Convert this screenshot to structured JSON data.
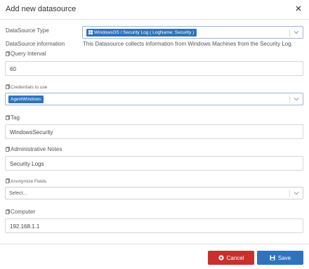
{
  "dialog": {
    "title": "Add new datasource"
  },
  "datasource_type": {
    "label": "DataSource Type",
    "selected": "WindowsOS / Security Log ( LogName: Security )"
  },
  "datasource_info": {
    "label": "DataSource information",
    "text": "This Datasource collects information from Windows Machines from the Security Log."
  },
  "query_interval": {
    "label": "Query Interval",
    "value": "60"
  },
  "credentials": {
    "label": "Credentials to use",
    "selected": "AgentWindows"
  },
  "tag": {
    "label": "Tag",
    "value": "WindowsSecurity"
  },
  "admin_notes": {
    "label": "Administrative Notes",
    "value": "Security Logs"
  },
  "anonymize": {
    "label": "Anonymize Fields",
    "placeholder": "Select..."
  },
  "computer": {
    "label": "Computer",
    "value": "192.168.1.1"
  },
  "buttons": {
    "cancel": "Cancel",
    "save": "Save"
  },
  "colors": {
    "cancel": "#c9302c",
    "primary": "#2f73bd"
  }
}
